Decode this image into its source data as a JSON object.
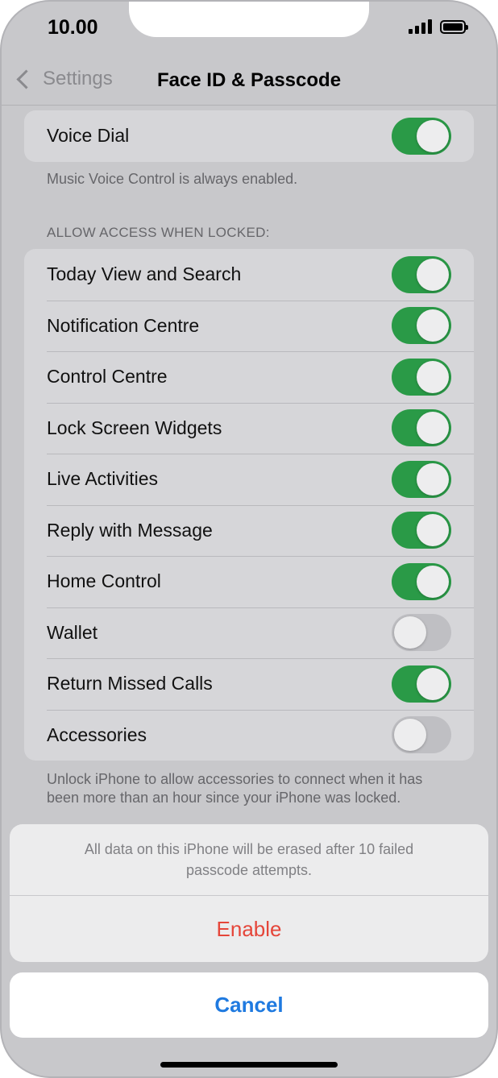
{
  "status_bar": {
    "time": "10.00"
  },
  "nav": {
    "back_label": "Settings",
    "title": "Face ID & Passcode"
  },
  "voice_dial": {
    "label": "Voice Dial",
    "on": true,
    "footnote": "Music Voice Control is always enabled."
  },
  "locked_access": {
    "header": "ALLOW ACCESS WHEN LOCKED:",
    "items": [
      {
        "label": "Today View and Search",
        "on": true
      },
      {
        "label": "Notification Centre",
        "on": true
      },
      {
        "label": "Control Centre",
        "on": true
      },
      {
        "label": "Lock Screen Widgets",
        "on": true
      },
      {
        "label": "Live Activities",
        "on": true
      },
      {
        "label": "Reply with Message",
        "on": true
      },
      {
        "label": "Home Control",
        "on": true
      },
      {
        "label": "Wallet",
        "on": false
      },
      {
        "label": "Return Missed Calls",
        "on": true
      },
      {
        "label": "Accessories",
        "on": false
      }
    ],
    "footnote": "Unlock iPhone to allow accessories to connect when it has been more than an hour since your iPhone was locked."
  },
  "action_sheet": {
    "message": "All data on this iPhone will be erased after 10 failed passcode attempts.",
    "enable_label": "Enable",
    "cancel_label": "Cancel"
  },
  "colors": {
    "toggle_on": "#2a9a47",
    "toggle_off": "#bfbfc3",
    "destructive": "#e5463a",
    "link": "#1f7ae0"
  }
}
